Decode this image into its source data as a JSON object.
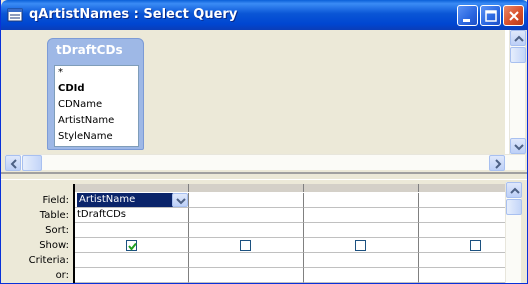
{
  "window": {
    "title": "qArtistNames : Select Query"
  },
  "design": {
    "table": {
      "title": "tDraftCDs",
      "fields": [
        "*",
        "CDId",
        "CDName",
        "ArtistName",
        "StyleName"
      ]
    }
  },
  "grid": {
    "row_labels": [
      "Field:",
      "Table:",
      "Sort:",
      "Show:",
      "Criteria:",
      "or:"
    ],
    "columns": [
      {
        "field": "ArtistName",
        "table": "tDraftCDs",
        "show": true
      },
      {
        "field": "",
        "table": "",
        "show": false
      },
      {
        "field": "",
        "table": "",
        "show": false
      },
      {
        "field": "",
        "table": "",
        "show": false
      }
    ]
  },
  "icons": {
    "app": "query-icon",
    "minimize": "minimize-icon",
    "maximize": "maximize-icon",
    "close": "close-icon"
  },
  "colors": {
    "titlebar": "#0a56d6",
    "table_header": "#9eb8e6",
    "selection": "#0a246a"
  }
}
